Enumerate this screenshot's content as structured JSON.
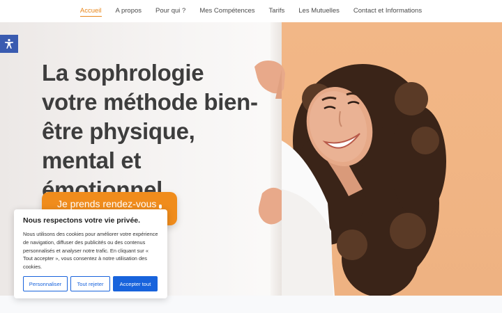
{
  "nav": {
    "items": [
      {
        "label": "Accueil",
        "active": true
      },
      {
        "label": "A propos"
      },
      {
        "label": "Pour qui ?"
      },
      {
        "label": "Mes Compétences"
      },
      {
        "label": "Tarifs"
      },
      {
        "label": "Les Mutuelles"
      },
      {
        "label": "Contact et Informations"
      }
    ]
  },
  "hero": {
    "title": "La sophrologie votre méthode bien-être physique, mental et émotionnel",
    "cta_label": "Je prends rendez-vous"
  },
  "accessibility": {
    "icon": "accessibility-icon"
  },
  "cookie": {
    "title": "Nous respectons votre vie privée.",
    "text": "Nous utilisons des cookies pour améliorer votre expérience de navigation, diffuser des publicités ou des contenus personnalisés et analyser notre trafic. En cliquant sur « Tout accepter », vous consentez à notre utilisation des cookies.",
    "btn_customize": "Personnaliser",
    "btn_reject": "Tout rejeter",
    "btn_accept": "Accepter tout"
  },
  "colors": {
    "accent": "#e8861a",
    "cta": "#f08c1c",
    "cookie_button": "#1863dc",
    "hero_right_bg": "#f2b787"
  }
}
